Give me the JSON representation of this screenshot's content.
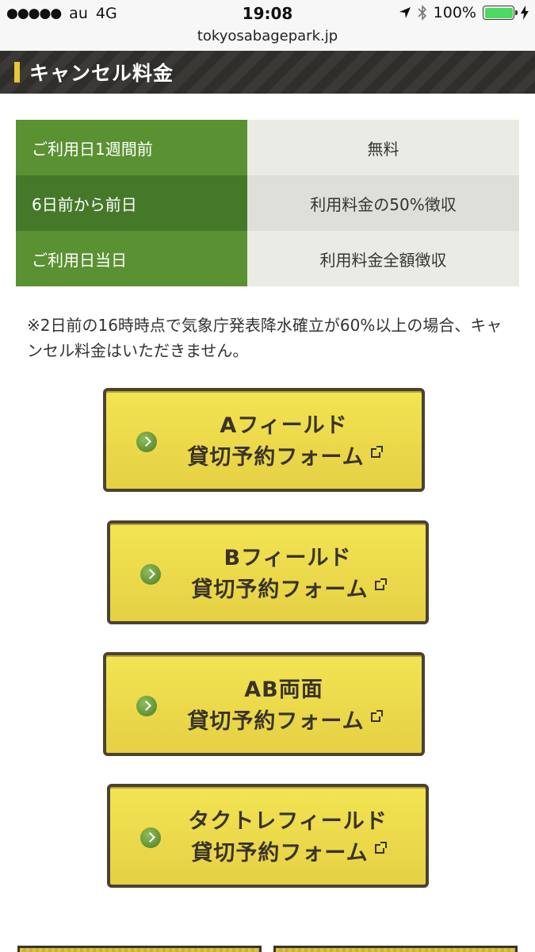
{
  "status_bar": {
    "signal_dots": "●●●●●",
    "carrier": "au",
    "network": "4G",
    "time": "19:08",
    "battery": "100%"
  },
  "url": "tokyosabagepark.jp",
  "section": {
    "title": "キャンセル料金"
  },
  "fees": [
    {
      "label": "ご利用日1週間前",
      "value": "無料"
    },
    {
      "label": "6日前から前日",
      "value": "利用料金の50%徴収"
    },
    {
      "label": "ご利用日当日",
      "value": "利用料金全額徴収"
    }
  ],
  "note": "※2日前の16時時点で気象庁発表降水確立が60%以上の場合、キャンセル料金はいただきません。",
  "buttons": [
    {
      "line1": "Aフィールド",
      "line2": "貸切予約フォーム"
    },
    {
      "line1": "Bフィールド",
      "line2": "貸切予約フォーム"
    },
    {
      "line1": "AB両面",
      "line2": "貸切予約フォーム"
    },
    {
      "line1": "タクトレフィールド",
      "line2": "貸切予約フォーム"
    }
  ],
  "icons": {
    "location": "location-arrow-icon",
    "bluetooth": "bluetooth-icon",
    "charging": "charging-bolt-icon",
    "external": "external-link-icon",
    "arrow": "arrow-right-circle-icon"
  },
  "colors": {
    "header_bg": "#2f2e2a",
    "accent_bar": "#e8c53a",
    "table_green": "#5a9233",
    "table_green_dark": "#46782a",
    "button_yellow": "#f2e453"
  }
}
